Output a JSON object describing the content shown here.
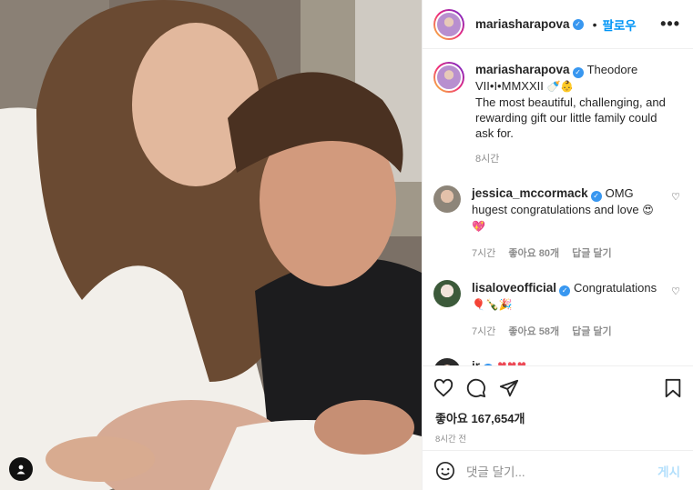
{
  "photo": {
    "alt_icon": "user-tag-icon"
  },
  "header": {
    "username": "mariasharapova",
    "verified_icon": "verified-badge-icon",
    "dot": "•",
    "follow_label": "팔로우",
    "more_icon": "more-options-icon",
    "more_label": "•••"
  },
  "caption": {
    "username": "mariasharapova",
    "text": "Theodore VII•I•MMXXII",
    "emoji": "🍼👶",
    "body": "The most beautiful, challenging, and rewarding gift our little family could ask for.",
    "time": "8시간"
  },
  "comments": [
    {
      "username": "jessica_mccormack",
      "text": "OMG hugest congratulations and love",
      "emoji": "😍💖",
      "time": "7시간",
      "likes": "좋아요 80개",
      "reply": "답글 달기"
    },
    {
      "username": "lisaloveofficial",
      "text": "Congratulations",
      "emoji": "🎈🍾🎉",
      "time": "7시간",
      "likes": "좋아요 58개",
      "reply": "답글 달기"
    },
    {
      "username": "jr",
      "text": "",
      "emoji": "♥♥♥",
      "time": "",
      "likes": "",
      "reply": ""
    }
  ],
  "actions": {
    "like_icon": "heart-icon",
    "comment_icon": "comment-icon",
    "share_icon": "send-icon",
    "save_icon": "bookmark-icon"
  },
  "likes_text": "좋아요 167,654개",
  "posted_time": "8시간 전",
  "add_comment": {
    "emoji_icon": "smiley-icon",
    "placeholder": "댓글 달기...",
    "post_label": "게시"
  },
  "colors": {
    "accent": "#0095f6",
    "verified": "#3897f0",
    "heart_red": "#ed4956"
  }
}
